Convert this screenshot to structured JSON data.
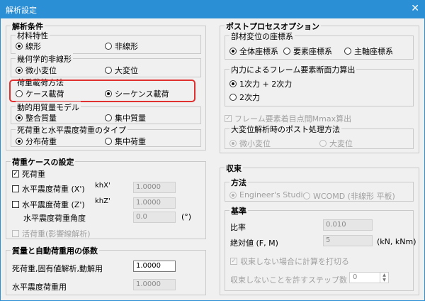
{
  "window": {
    "title": "解析設定",
    "close": "✕"
  },
  "analysis": {
    "title": "解析条件",
    "material": {
      "title": "材料特性",
      "linear": "線形",
      "nonlinear": "非線形",
      "selected": "linear"
    },
    "geometric": {
      "title": "幾何学的非線形",
      "small": "微小変位",
      "large": "大変位",
      "selected": "small"
    },
    "load_method": {
      "title": "荷重載荷方法",
      "case": "ケース載荷",
      "sequence": "シーケンス載荷",
      "selected": "sequence"
    },
    "mass": {
      "title": "動的用質量モデル",
      "consistent": "整合質量",
      "lumped": "集中質量",
      "selected": "consistent"
    },
    "dead_load": {
      "title": "死荷重と水平震度荷重のタイプ",
      "distributed": "分布荷重",
      "concentrated": "集中荷重",
      "selected": "distributed"
    }
  },
  "load_case": {
    "title": "荷重ケースの設定",
    "dead": {
      "label": "死荷重",
      "checked": true
    },
    "hx": {
      "label": "水平震度荷重 (X')",
      "unit": "khX'",
      "value": "1.0000",
      "checked": false
    },
    "hz": {
      "label": "水平震度荷重 (Z')",
      "unit": "khZ'",
      "value": "1.0000",
      "checked": false
    },
    "angle": {
      "label": "水平震度荷重角度",
      "value": "0.0",
      "unit": "(°)"
    },
    "live": {
      "label": "活荷重(影響線解析)",
      "checked": false
    }
  },
  "mass_factor": {
    "title": "質量と自動荷重用の係数",
    "dead_label": "死荷重,固有値解析,動解用",
    "dead_value": "1.0000",
    "seismic_label": "水平震度荷重用",
    "seismic_value": "1.0000"
  },
  "post": {
    "title": "ポストプロセスオプション",
    "coord": {
      "title": "部材変位の座標系",
      "global": "全体座標系",
      "element": "要素座標系",
      "principal": "主軸座標系",
      "selected": "global"
    },
    "force": {
      "title": "内力によるフレーム要素断面力算出",
      "first": "1次力 + 2次力",
      "second": "2次力",
      "selected": "first"
    },
    "mmax": {
      "label": "フレーム要素着目点間Mmax算出",
      "checked": true
    },
    "large_disp": {
      "title": "大変位解析時のポスト処理方法",
      "small": "微小変位",
      "large": "大変位",
      "selected": "small"
    }
  },
  "convergence": {
    "title": "収束",
    "method": {
      "title": "方法",
      "studio": "Engineer's Studio",
      "wcomd": "WCOMD (非線形 平板)",
      "selected": "studio"
    },
    "criteria": {
      "title": "基準",
      "ratio_label": "比率",
      "ratio_value": "0.010",
      "abs_label": "絶対値 (F, M)",
      "abs_value": "5",
      "abs_unit": "(kN, kNm)",
      "calc_label": "収束しない場合に計算を打切る",
      "calc_checked": true,
      "steps_label": "収束しないことを許すステップ数",
      "steps_value": "0"
    }
  }
}
